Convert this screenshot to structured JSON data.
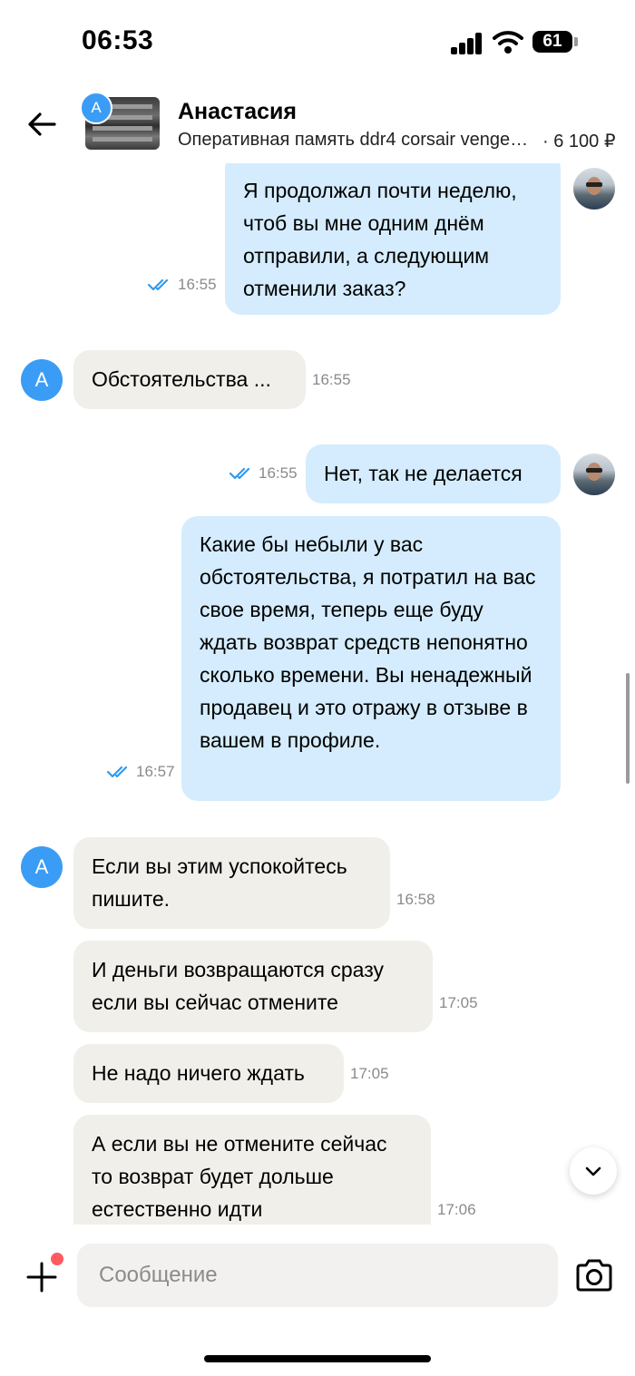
{
  "status_bar": {
    "time": "06:53",
    "battery": "61"
  },
  "header": {
    "contact_name": "Анастасия",
    "avatar_letter": "А",
    "product": "Оперативная память ddr4 corsair vengeance",
    "price": "· 6 100 ₽"
  },
  "messages": [
    {
      "dir": "out",
      "text": "Я продолжал почти неделю, чтоб вы мне одним днём отправили, а следующим отменили заказ?",
      "time": "16:55",
      "read": true
    },
    {
      "dir": "in",
      "text": "Обстоятельства ...",
      "time": "16:55"
    },
    {
      "dir": "out",
      "text": "Нет, так не делается",
      "time": "16:55",
      "read": true
    },
    {
      "dir": "out",
      "text": "Какие бы небыли у вас обстоятельства, я потратил на вас свое время, теперь еще буду ждать возврат средств непонятно сколько времени. Вы ненадежный продавец и это отражу в отзыве в вашем в профиле.",
      "time": "16:57",
      "read": true
    },
    {
      "dir": "in",
      "text": "Если вы этим успокойтесь пишите.",
      "time": "16:58"
    },
    {
      "dir": "in",
      "text": "И деньги возвращаются сразу если вы сейчас отмените",
      "time": "17:05"
    },
    {
      "dir": "in",
      "text": "Не надо ничего ждать",
      "time": "17:05"
    },
    {
      "dir": "in",
      "text": "А если вы не отмените сейчас то возврат будет дольше естественно идти",
      "time": "17:06"
    }
  ],
  "composer": {
    "placeholder": "Сообщение"
  },
  "icons": {
    "back": "arrow-left-icon",
    "plus": "plus-icon",
    "camera": "camera-icon",
    "scroll_down": "chevron-down-icon",
    "read": "double-check-icon"
  },
  "colors": {
    "outgoing_bubble": "#d4ecfd",
    "incoming_bubble": "#f1efea",
    "accent": "#3b9cf5",
    "tick": "#2f9bf0",
    "notification_dot": "#ff5a5f"
  }
}
